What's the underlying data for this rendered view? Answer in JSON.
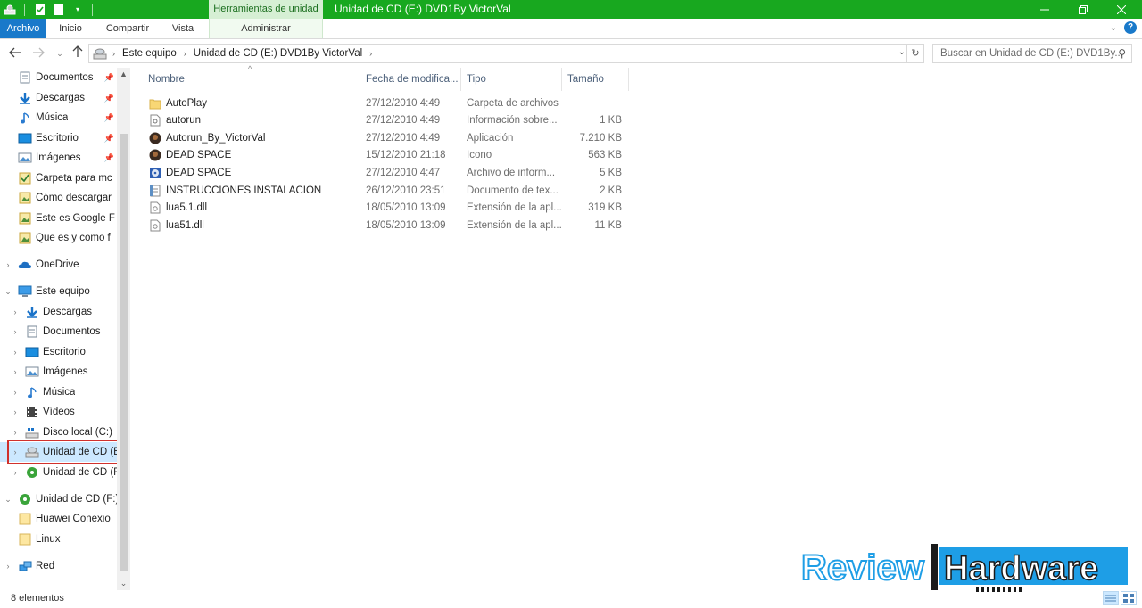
{
  "window": {
    "title": "Unidad de CD (E:) DVD1By VictorVal",
    "context_tab_group": "Herramientas de unidad"
  },
  "ribbon": {
    "tabs": [
      {
        "label": "Archivo"
      },
      {
        "label": "Inicio"
      },
      {
        "label": "Compartir"
      },
      {
        "label": "Vista"
      },
      {
        "label": "Administrar"
      }
    ]
  },
  "address": {
    "crumbs": [
      "Este equipo",
      "Unidad de CD (E:) DVD1By VictorVal"
    ],
    "search_placeholder": "Buscar en Unidad de CD (E:) DVD1By..."
  },
  "nav_pane": {
    "quick_access": [
      {
        "label": "Documentos",
        "icon": "documents-icon",
        "pinned": true
      },
      {
        "label": "Descargas",
        "icon": "downloads-icon",
        "pinned": true
      },
      {
        "label": "Música",
        "icon": "music-icon",
        "pinned": true
      },
      {
        "label": "Escritorio",
        "icon": "desktop-icon",
        "pinned": true
      },
      {
        "label": "Imágenes",
        "icon": "pictures-icon",
        "pinned": true
      },
      {
        "label": "Carpeta para mc",
        "icon": "folder-check-icon"
      },
      {
        "label": "Cómo descargar",
        "icon": "folder-image-icon"
      },
      {
        "label": "Este es Google F",
        "icon": "folder-image-icon"
      },
      {
        "label": "Que es y como f",
        "icon": "folder-image-icon"
      }
    ],
    "onedrive": "OneDrive",
    "this_pc": "Este equipo",
    "this_pc_items": [
      {
        "label": "Descargas",
        "icon": "downloads-icon"
      },
      {
        "label": "Documentos",
        "icon": "documents-icon"
      },
      {
        "label": "Escritorio",
        "icon": "desktop-icon"
      },
      {
        "label": "Imágenes",
        "icon": "pictures-icon"
      },
      {
        "label": "Música",
        "icon": "music-icon"
      },
      {
        "label": "Vídeos",
        "icon": "videos-icon"
      },
      {
        "label": "Disco local (C:)",
        "icon": "local-disk-icon"
      },
      {
        "label": "Unidad de CD (E",
        "icon": "cd-drive-icon",
        "selected": true
      },
      {
        "label": "Unidad de CD (F",
        "icon": "cd-green-icon"
      }
    ],
    "cd_f": "Unidad de CD (F:)",
    "cd_f_items": [
      {
        "label": "Huawei Conexio",
        "icon": "folder-icon"
      },
      {
        "label": "Linux",
        "icon": "folder-icon"
      }
    ],
    "network": "Red"
  },
  "file_list": {
    "columns": [
      "Nombre",
      "Fecha de modifica...",
      "Tipo",
      "Tamaño"
    ],
    "rows": [
      {
        "name": "AutoPlay",
        "date": "27/12/2010 4:49",
        "type": "Carpeta de archivos",
        "size": "",
        "icon": "folder-icon"
      },
      {
        "name": "autorun",
        "date": "27/12/2010 4:49",
        "type": "Información sobre...",
        "size": "1 KB",
        "icon": "settings-file-icon"
      },
      {
        "name": "Autorun_By_VictorVal",
        "date": "27/12/2010 4:49",
        "type": "Aplicación",
        "size": "7.210 KB",
        "icon": "app-icon"
      },
      {
        "name": "DEAD SPACE",
        "date": "15/12/2010 21:18",
        "type": "Icono",
        "size": "563 KB",
        "icon": "app-icon"
      },
      {
        "name": "DEAD SPACE",
        "date": "27/12/2010 4:47",
        "type": "Archivo de inform...",
        "size": "5 KB",
        "icon": "disc-info-icon"
      },
      {
        "name": "INSTRUCCIONES INSTALACION",
        "date": "26/12/2010 23:51",
        "type": "Documento de tex...",
        "size": "2 KB",
        "icon": "text-doc-icon"
      },
      {
        "name": "lua5.1.dll",
        "date": "18/05/2010 13:09",
        "type": "Extensión de la apl...",
        "size": "319 KB",
        "icon": "dll-icon"
      },
      {
        "name": "lua51.dll",
        "date": "18/05/2010 13:09",
        "type": "Extensión de la apl...",
        "size": "11 KB",
        "icon": "dll-icon"
      }
    ]
  },
  "status": {
    "count": "8 elementos"
  },
  "watermark": {
    "left": "Review",
    "right": "Hardware"
  },
  "colors": {
    "title_bar": "#18a81f",
    "file_tab": "#1979ca",
    "selection": "#cce8ff",
    "highlight_box": "#d0312d",
    "logo_blue": "#1e9ee6"
  }
}
